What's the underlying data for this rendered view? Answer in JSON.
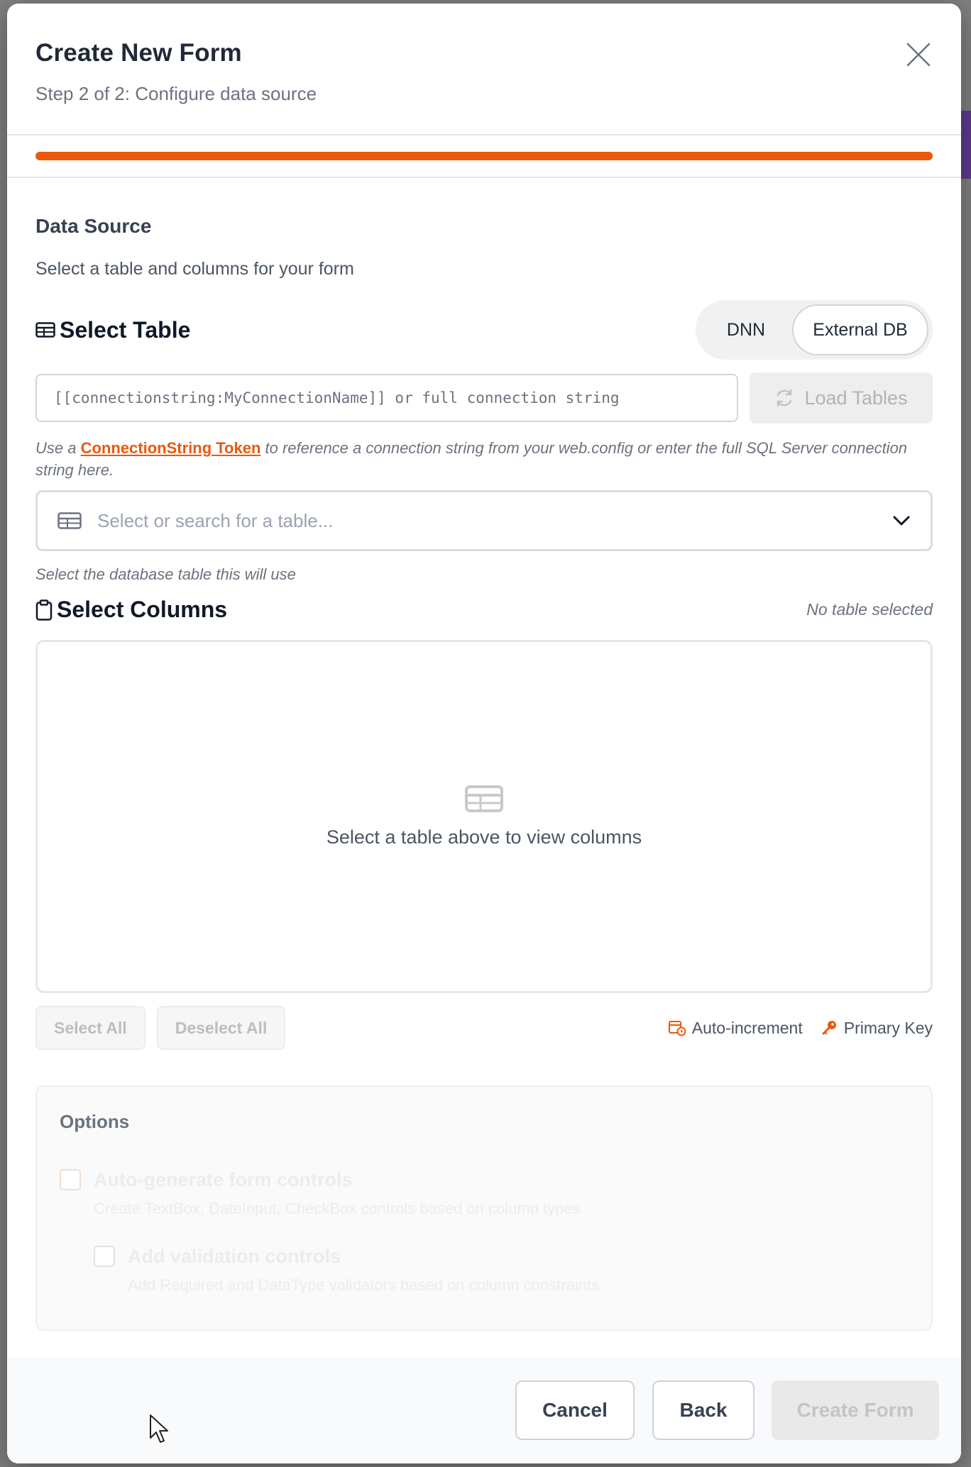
{
  "modal": {
    "title": "Create New Form",
    "subtitle": "Step 2 of 2: Configure data source",
    "progress_percent": 100,
    "accent_color": "#ea580c"
  },
  "data_source": {
    "title": "Data Source",
    "description": "Select a table and columns for your form"
  },
  "select_table": {
    "heading": "Select Table",
    "source_toggle": {
      "options": [
        "DNN",
        "External DB"
      ],
      "selected": "External DB"
    },
    "connection_placeholder": "[[connectionstring:MyConnectionName]] or full connection string",
    "load_tables_label": "Load Tables",
    "hint_prefix": "Use a ",
    "hint_link": "ConnectionString Token",
    "hint_suffix": " to reference a connection string from your web.config or enter the full SQL Server connection string here.",
    "table_placeholder": "Select or search for a table...",
    "table_help": "Select the database table this will use"
  },
  "select_columns": {
    "heading": "Select Columns",
    "status": "No table selected",
    "empty_message": "Select a table above to view columns",
    "select_all_label": "Select All",
    "deselect_all_label": "Deselect All",
    "legend": {
      "auto_increment": "Auto-increment",
      "primary_key": "Primary Key"
    }
  },
  "options": {
    "heading": "Options",
    "auto_generate_label": "Auto-generate form controls",
    "auto_generate_desc": "Create TextBox, DateInput, CheckBox controls based on column types",
    "validation_label": "Add validation controls",
    "validation_desc": "Add Required and DataType validators based on column constraints"
  },
  "footer": {
    "cancel_label": "Cancel",
    "back_label": "Back",
    "create_label": "Create Form"
  }
}
